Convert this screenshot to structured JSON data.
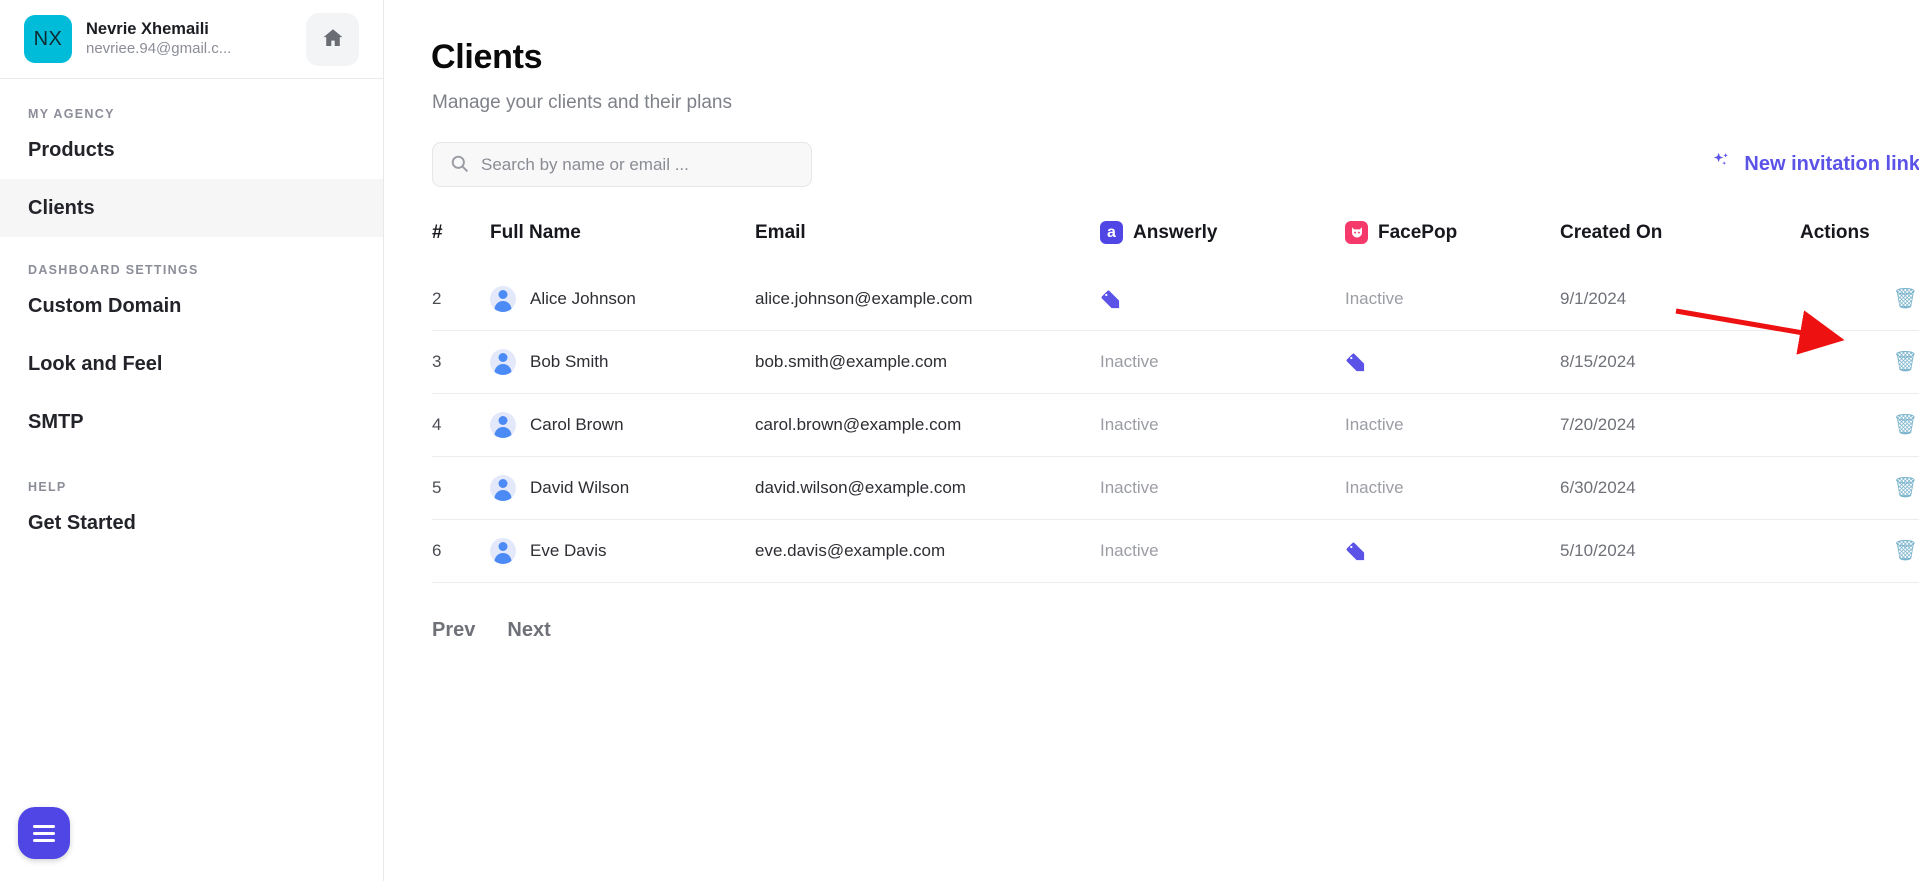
{
  "sidebar": {
    "user": {
      "initials": "NX",
      "name": "Nevrie Xhemaili",
      "email": "nevriee.94@gmail.c...",
      "avatar_color": "#00bcd9",
      "home_icon": "home-icon"
    },
    "groups": [
      {
        "label": "MY AGENCY",
        "items": [
          {
            "label": "Products",
            "active": false
          },
          {
            "label": "Clients",
            "active": true
          }
        ]
      },
      {
        "label": "DASHBOARD SETTINGS",
        "items": [
          {
            "label": "Custom Domain",
            "active": false
          },
          {
            "label": "Look and Feel",
            "active": false
          },
          {
            "label": "SMTP",
            "active": false
          }
        ]
      },
      {
        "label": "HELP",
        "items": [
          {
            "label": "Get Started",
            "active": false
          }
        ]
      }
    ],
    "fab": {
      "icon": "hamburger-menu-icon",
      "color": "#4f46e5"
    }
  },
  "main": {
    "title": "Clients",
    "subtitle": "Manage your clients and their plans",
    "search": {
      "placeholder": "Search by name or email ...",
      "value": "",
      "icon": "search-icon"
    },
    "invite": {
      "label": "New invitation link",
      "icon": "sparkles-icon",
      "color": "#5b53e8"
    },
    "table": {
      "headers": {
        "num": "#",
        "name": "Full Name",
        "email": "Email",
        "answerly": "Answerly",
        "facepop": "FacePop",
        "created": "Created On",
        "actions": "Actions"
      },
      "app_icons": {
        "answerly": {
          "glyph": "a",
          "color": "#4f46e5"
        },
        "facepop": {
          "glyph": "cat-face-icon",
          "color": "#f5396a"
        }
      },
      "inactive_label": "Inactive",
      "active_icon": "tag-icon",
      "delete_icon": "trash-icon",
      "rows": [
        {
          "num": "2",
          "name": "Alice Johnson",
          "email": "alice.johnson@example.com",
          "answerly": "active",
          "facepop": "inactive",
          "created": "9/1/2024"
        },
        {
          "num": "3",
          "name": "Bob Smith",
          "email": "bob.smith@example.com",
          "answerly": "inactive",
          "facepop": "active",
          "created": "8/15/2024"
        },
        {
          "num": "4",
          "name": "Carol Brown",
          "email": "carol.brown@example.com",
          "answerly": "inactive",
          "facepop": "inactive",
          "created": "7/20/2024"
        },
        {
          "num": "5",
          "name": "David Wilson",
          "email": "david.wilson@example.com",
          "answerly": "inactive",
          "facepop": "inactive",
          "created": "6/30/2024"
        },
        {
          "num": "6",
          "name": "Eve Davis",
          "email": "eve.davis@example.com",
          "answerly": "inactive",
          "facepop": "active",
          "created": "5/10/2024"
        }
      ]
    },
    "pagination": {
      "prev": "Prev",
      "next": "Next"
    }
  },
  "annotation": {
    "type": "arrow",
    "color": "#ee1111",
    "points_to": "delete-row-button-row-2"
  }
}
